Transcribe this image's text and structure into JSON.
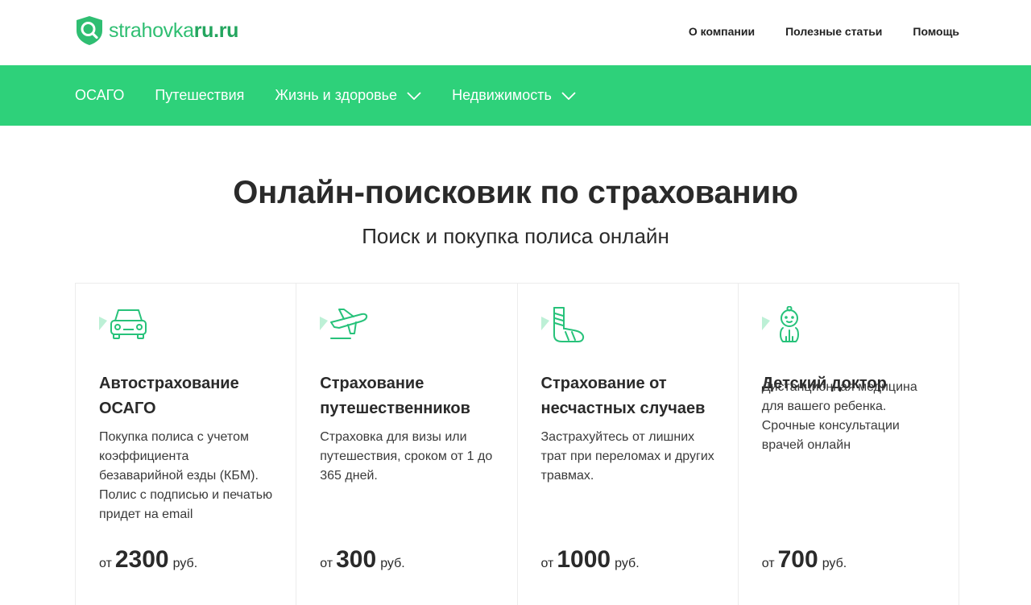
{
  "header": {
    "logo": {
      "part1": "strahovka",
      "part2": "ru.ru"
    },
    "nav": [
      "О компании",
      "Полезные статьи",
      "Помощь"
    ]
  },
  "menu": {
    "items": [
      {
        "label": "ОСАГО",
        "has_dropdown": false
      },
      {
        "label": "Путешествия",
        "has_dropdown": false
      },
      {
        "label": "Жизнь и здоровье",
        "has_dropdown": true
      },
      {
        "label": "Недвижимость",
        "has_dropdown": true
      }
    ]
  },
  "hero": {
    "title": "Онлайн-поисковик по страхованию",
    "subtitle": "Поиск и покупка полиса онлайн"
  },
  "cards": [
    {
      "icon": "car-icon",
      "title_line1": "Автострахование",
      "title_line2": "ОСАГО",
      "description": "Покупка полиса с учетом коэффициента безаварийной езды (КБМ). Полис с подписью и печатью придет на email",
      "price_prefix": "от",
      "price": "2300",
      "price_suffix": "руб."
    },
    {
      "icon": "airplane-icon",
      "title_line1": "Страхование",
      "title_line2": "путешественников",
      "description": "Страховка для визы или путешествия, сроком от 1 до 365 дней.",
      "price_prefix": "от",
      "price": "300",
      "price_suffix": "руб."
    },
    {
      "icon": "bandaged-leg-icon",
      "title_line1": "Страхование от",
      "title_line2": "несчастных случаев",
      "description": "Застрахуйтесь от лишних трат при переломах и других травмах.",
      "price_prefix": "от",
      "price": "1000",
      "price_suffix": "руб."
    },
    {
      "icon": "baby-icon",
      "title_line1": "Детский доктор",
      "title_line2": "",
      "description": "Дистанционная медицина для вашего ребенка. Срочные консультации врачей онлайн",
      "price_prefix": "от",
      "price": "700",
      "price_suffix": "руб."
    }
  ],
  "colors": {
    "brand_green": "#2ed17a",
    "logo_green": "#2fbe72",
    "icon_green": "#27c27a"
  }
}
